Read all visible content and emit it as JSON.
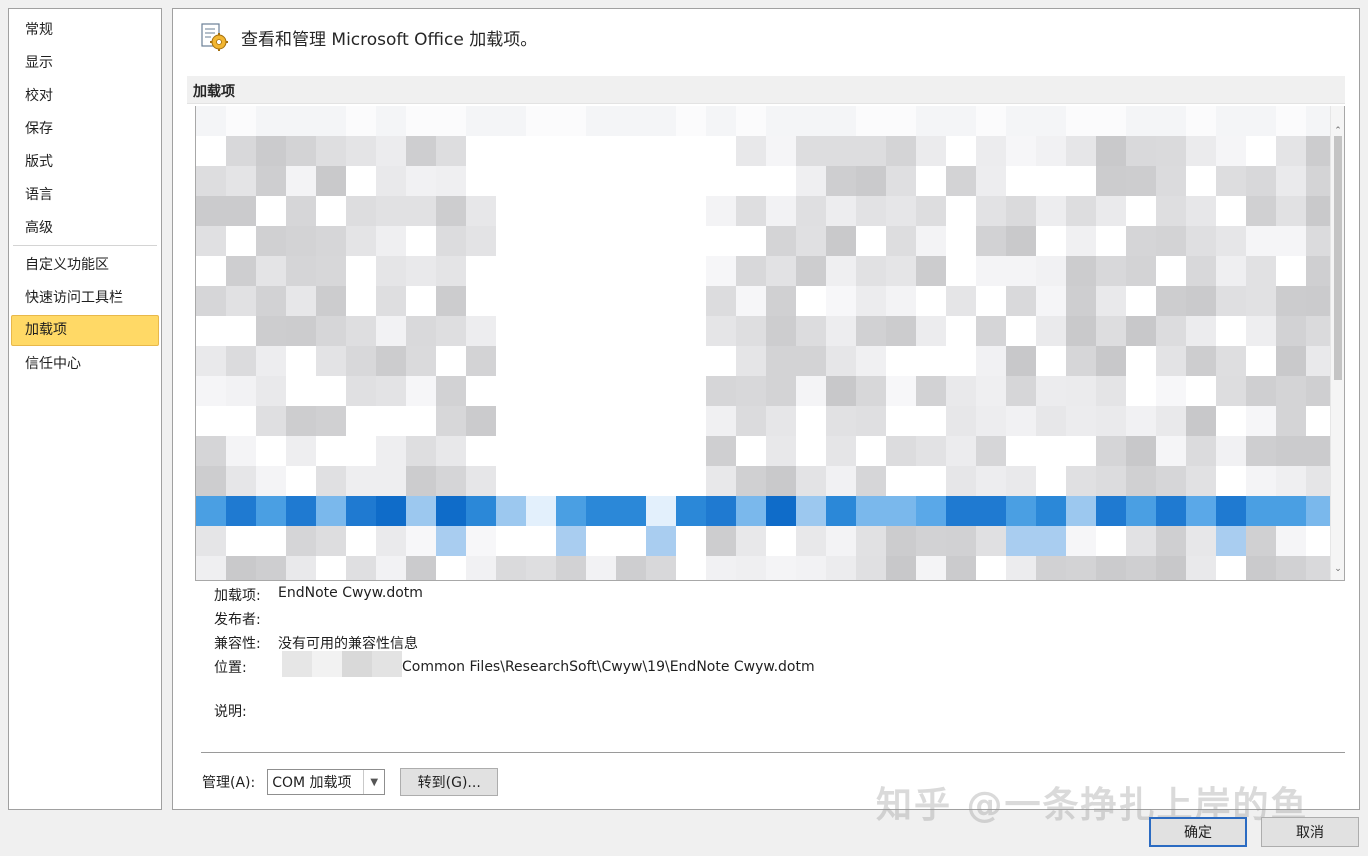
{
  "nav": {
    "items": [
      {
        "label": "常规"
      },
      {
        "label": "显示"
      },
      {
        "label": "校对"
      },
      {
        "label": "保存"
      },
      {
        "label": "版式"
      },
      {
        "label": "语言"
      },
      {
        "label": "高级"
      },
      {
        "label": "自定义功能区"
      },
      {
        "label": "快速访问工具栏"
      },
      {
        "label": "加载项",
        "selected": true
      },
      {
        "label": "信任中心"
      }
    ]
  },
  "header": {
    "title": "查看和管理 Microsoft Office 加载项。"
  },
  "section": {
    "title": "加载项"
  },
  "details": {
    "addin_label": "加载项:",
    "addin_value": "EndNote Cwyw.dotm",
    "publisher_label": "发布者:",
    "publisher_value": "",
    "compat_label": "兼容性:",
    "compat_value": "没有可用的兼容性信息",
    "location_label": "位置:",
    "location_value": "Common Files\\ResearchSoft\\Cwyw\\19\\EndNote Cwyw.dotm",
    "description_label": "说明:",
    "description_value": ""
  },
  "manage": {
    "label": "管理(A):",
    "selected": "COM 加载项",
    "goto_label": "转到(G)..."
  },
  "footer": {
    "ok_label": "确定",
    "cancel_label": "取消"
  },
  "watermark": "知乎 @一条挣扎上岸的鱼",
  "colors": {
    "nav_selected": "#ffd966",
    "ok_border": "#2b6bc2"
  }
}
